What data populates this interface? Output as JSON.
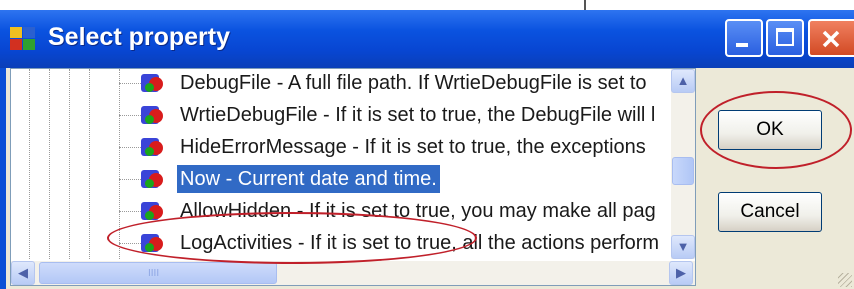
{
  "window": {
    "title": "Select property",
    "title_icon": "app-window-icon",
    "controls": [
      "minimize-icon",
      "maximize-icon",
      "close-icon"
    ]
  },
  "list": {
    "items": [
      {
        "label": "DebugFile - A full file path. If WrtieDebugFile is set to",
        "selected": false
      },
      {
        "label": "WrtieDebugFile - If it is set to true, the DebugFile will l",
        "selected": false
      },
      {
        "label": "HideErrorMessage - If it is set to true, the exceptions",
        "selected": false
      },
      {
        "label": "Now - Current date and time.",
        "selected": true
      },
      {
        "label": "AllowHidden - If it is set to true, you may make all pag",
        "selected": false
      },
      {
        "label": "LogActivities - If it is set to true, all the actions perform",
        "selected": false
      }
    ],
    "node_icon": "property-icon"
  },
  "buttons": {
    "ok": "OK",
    "cancel": "Cancel"
  },
  "scrollbar": {
    "up_glyph": "▲",
    "down_glyph": "▼",
    "left_glyph": "◀",
    "right_glyph": "▶",
    "h_grip": "IIII"
  },
  "colors": {
    "titlebar": "#0b53e0",
    "selection": "#316ac5",
    "annotation": "#c0202a"
  }
}
